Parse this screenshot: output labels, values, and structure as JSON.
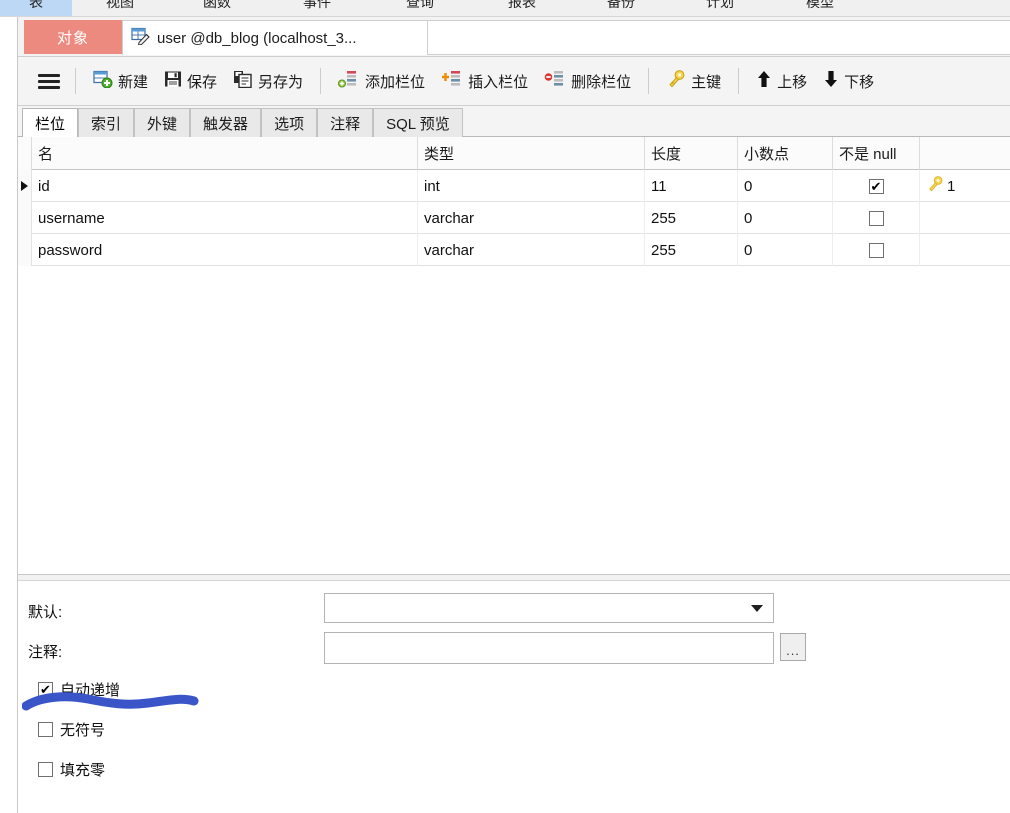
{
  "main_menu": {
    "items": [
      {
        "label": "表",
        "selected": true
      },
      {
        "label": "视图",
        "selected": false
      },
      {
        "label": "函数",
        "selected": false
      },
      {
        "label": "事件",
        "selected": false
      },
      {
        "label": "查询",
        "selected": false
      },
      {
        "label": "报表",
        "selected": false
      },
      {
        "label": "备份",
        "selected": false
      },
      {
        "label": "计划",
        "selected": false
      },
      {
        "label": "模型",
        "selected": false
      }
    ]
  },
  "tab_bar": {
    "object_tab_label": "对象",
    "object_tab_color": "#ec8a80",
    "document_tab_label": "user @db_blog (localhost_3...",
    "document_tab_icon": "table-edit-icon"
  },
  "toolbar": {
    "menu_icon": "hamburger-icon",
    "buttons": [
      {
        "label": "新建",
        "icon": "new-table-icon"
      },
      {
        "label": "保存",
        "icon": "save-icon"
      },
      {
        "label": "另存为",
        "icon": "save-as-icon"
      },
      {
        "label": "添加栏位",
        "icon": "add-field-icon"
      },
      {
        "label": "插入栏位",
        "icon": "insert-field-icon"
      },
      {
        "label": "删除栏位",
        "icon": "delete-field-icon"
      },
      {
        "label": "主键",
        "icon": "primary-key-icon"
      },
      {
        "label": "上移",
        "icon": "arrow-up-icon"
      },
      {
        "label": "下移",
        "icon": "arrow-down-icon"
      }
    ]
  },
  "inner_tabs": {
    "items": [
      {
        "label": "栏位",
        "active": true
      },
      {
        "label": "索引",
        "active": false
      },
      {
        "label": "外键",
        "active": false
      },
      {
        "label": "触发器",
        "active": false
      },
      {
        "label": "选项",
        "active": false
      },
      {
        "label": "注释",
        "active": false
      },
      {
        "label": "SQL 预览",
        "active": false
      }
    ]
  },
  "grid": {
    "columns": [
      "名",
      "类型",
      "长度",
      "小数点",
      "不是 null"
    ],
    "rows": [
      {
        "selected": true,
        "name": "id",
        "type": "int",
        "length": "11",
        "decimals": "0",
        "not_null": true,
        "key_badge": "1",
        "key_icon": "primary-key-icon"
      },
      {
        "selected": false,
        "name": "username",
        "type": "varchar",
        "length": "255",
        "decimals": "0",
        "not_null": false,
        "key_badge": "",
        "key_icon": ""
      },
      {
        "selected": false,
        "name": "password",
        "type": "varchar",
        "length": "255",
        "decimals": "0",
        "not_null": false,
        "key_badge": "",
        "key_icon": ""
      }
    ]
  },
  "properties": {
    "default_label": "默认:",
    "default_value": "",
    "comment_label": "注释:",
    "comment_value": "",
    "browse_button_label": "...",
    "checkboxes": [
      {
        "label": "自动递增",
        "checked": true
      },
      {
        "label": "无符号",
        "checked": false
      },
      {
        "label": "填充零",
        "checked": false
      }
    ]
  },
  "annotation": {
    "type": "hand-drawn-underline",
    "color": "#3a55c8",
    "target": "自动递增"
  }
}
